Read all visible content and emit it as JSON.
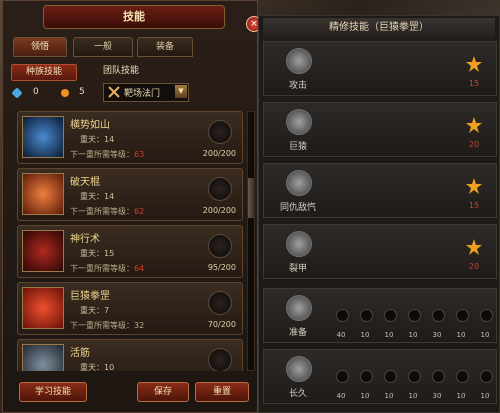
{
  "window": {
    "title": "技能"
  },
  "tabs": [
    {
      "label": "领悟"
    },
    {
      "label": "一般"
    },
    {
      "label": "装备"
    }
  ],
  "subtabs": [
    {
      "label": "种族技能"
    },
    {
      "label": "团队技能"
    }
  ],
  "stats": {
    "blue_points": "0",
    "orange_points": "5"
  },
  "school": {
    "label": "靶场法门",
    "dropdown": "▼"
  },
  "skills": [
    {
      "name": "横势如山",
      "level": "重天：14",
      "next_label": "下一重所需等级：",
      "next_req": "63",
      "cost": "200/200"
    },
    {
      "name": "破天棍",
      "level": "重天：14",
      "next_label": "下一重所需等级：",
      "next_req": "62",
      "cost": "200/200"
    },
    {
      "name": "神行术",
      "level": "重天：15",
      "next_label": "下一重所需等级：",
      "next_req": "64",
      "cost": "95/200"
    },
    {
      "name": "巨猿拳罡",
      "level": "重天：7",
      "next_label": "下一重所需等级：32",
      "next_req": "",
      "cost": "70/200"
    },
    {
      "name": "活筋",
      "level": "重天：10",
      "next_label": "",
      "next_req": "",
      "cost": ""
    }
  ],
  "buttons": {
    "learn": "学习技能",
    "save": "保存",
    "reset": "重置",
    "close": "×"
  },
  "right_panel": {
    "title": "精修技能（巨猿拳罡）",
    "rows": [
      {
        "name": "攻击",
        "number": "15"
      },
      {
        "name": "巨猿",
        "number": "20"
      },
      {
        "name": "同仇敌忾",
        "number": "15"
      },
      {
        "name": "裂甲",
        "number": "20"
      }
    ],
    "track_rows": [
      {
        "name": "准备",
        "numbers": [
          "40",
          "10",
          "10",
          "10",
          "30",
          "10",
          "10"
        ]
      },
      {
        "name": "长久",
        "numbers": [
          "40",
          "10",
          "10",
          "10",
          "30",
          "10",
          "10"
        ]
      }
    ]
  },
  "colors": {
    "accent_red": "#8a2a18",
    "gold": "#f0d690",
    "req_red": "#d04030"
  }
}
